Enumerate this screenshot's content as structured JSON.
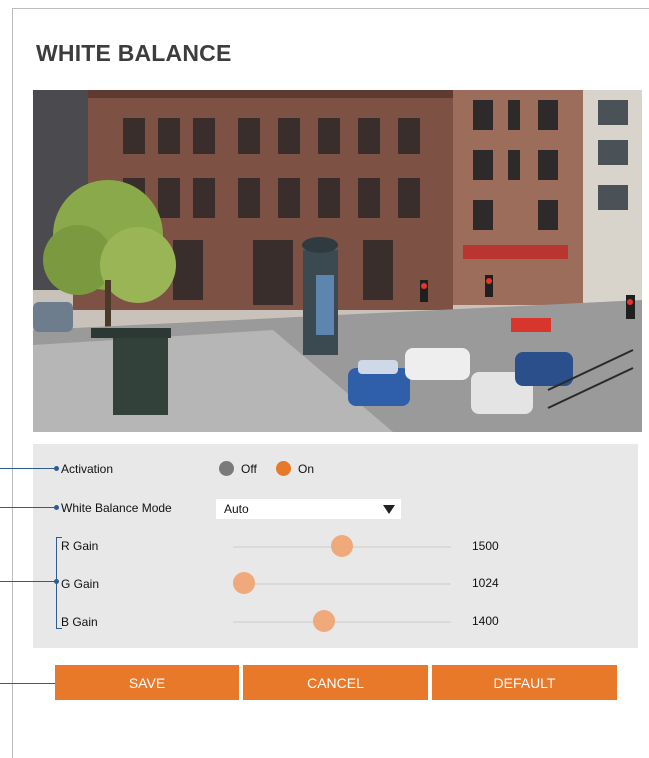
{
  "page": {
    "title": "WHITE BALANCE"
  },
  "camera": {
    "description_icon": "camera-preview"
  },
  "activation": {
    "label": "Activation",
    "options": [
      {
        "label": "Off",
        "selected": false
      },
      {
        "label": "On",
        "selected": true
      }
    ]
  },
  "mode": {
    "label": "White Balance Mode",
    "value": "Auto"
  },
  "gains": [
    {
      "label": "R Gain",
      "value": "1500",
      "fraction": 0.5
    },
    {
      "label": "G Gain",
      "value": "1024",
      "fraction": 0.0
    },
    {
      "label": "B Gain",
      "value": "1400",
      "fraction": 0.41
    }
  ],
  "buttons": {
    "save": "SAVE",
    "cancel": "CANCEL",
    "default": "DEFAULT"
  },
  "colors": {
    "accent": "#e8782a",
    "panel": "#e8e8e8",
    "pointer": "#2d5d8c"
  }
}
